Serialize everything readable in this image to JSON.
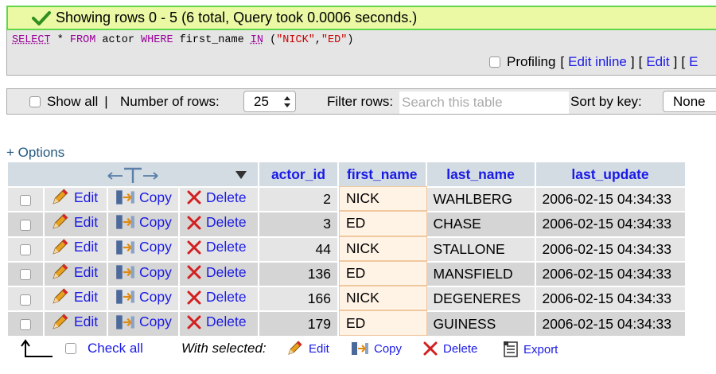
{
  "success": {
    "message": "Showing rows 0 - 5 (6 total, Query took 0.0006 seconds.)"
  },
  "sql": {
    "select": "SELECT",
    "star": " * ",
    "from": "FROM",
    "table": " actor ",
    "where": "WHERE",
    "field": " first_name ",
    "in": "IN",
    "open": " (",
    "v1": "\"NICK\"",
    "comma": ",",
    "v2": "\"ED\"",
    "close": ")"
  },
  "profiling": {
    "label": "Profiling",
    "edit_inline": "Edit inline",
    "edit": "Edit",
    "explain": "E"
  },
  "navbar": {
    "show_all": "Show all",
    "separator": "|",
    "number_of_rows_label": "Number of rows:",
    "number_of_rows_value": "25",
    "filter_label": "Filter rows:",
    "filter_placeholder": "Search this table",
    "sort_label": "Sort by key:",
    "sort_value": "None"
  },
  "options_link": "+ Options",
  "table": {
    "headers": [
      "actor_id",
      "first_name",
      "last_name",
      "last_update"
    ],
    "action_labels": {
      "edit": "Edit",
      "copy": "Copy",
      "delete": "Delete"
    },
    "rows": [
      {
        "actor_id": "2",
        "first_name": "NICK",
        "last_name": "WAHLBERG",
        "last_update": "2006-02-15 04:34:33"
      },
      {
        "actor_id": "3",
        "first_name": "ED",
        "last_name": "CHASE",
        "last_update": "2006-02-15 04:34:33"
      },
      {
        "actor_id": "44",
        "first_name": "NICK",
        "last_name": "STALLONE",
        "last_update": "2006-02-15 04:34:33"
      },
      {
        "actor_id": "136",
        "first_name": "ED",
        "last_name": "MANSFIELD",
        "last_update": "2006-02-15 04:34:33"
      },
      {
        "actor_id": "166",
        "first_name": "NICK",
        "last_name": "DEGENERES",
        "last_update": "2006-02-15 04:34:33"
      },
      {
        "actor_id": "179",
        "first_name": "ED",
        "last_name": "GUINESS",
        "last_update": "2006-02-15 04:34:33"
      }
    ]
  },
  "footer": {
    "check_all": "Check all",
    "with_selected": "With selected:",
    "edit": "Edit",
    "copy": "Copy",
    "delete": "Delete",
    "export": "Export"
  },
  "colors": {
    "success_bg": "#ebf8a4",
    "success_border": "#62d64b",
    "link": "#1a1ae6",
    "header_bg": "#d3dce3"
  }
}
